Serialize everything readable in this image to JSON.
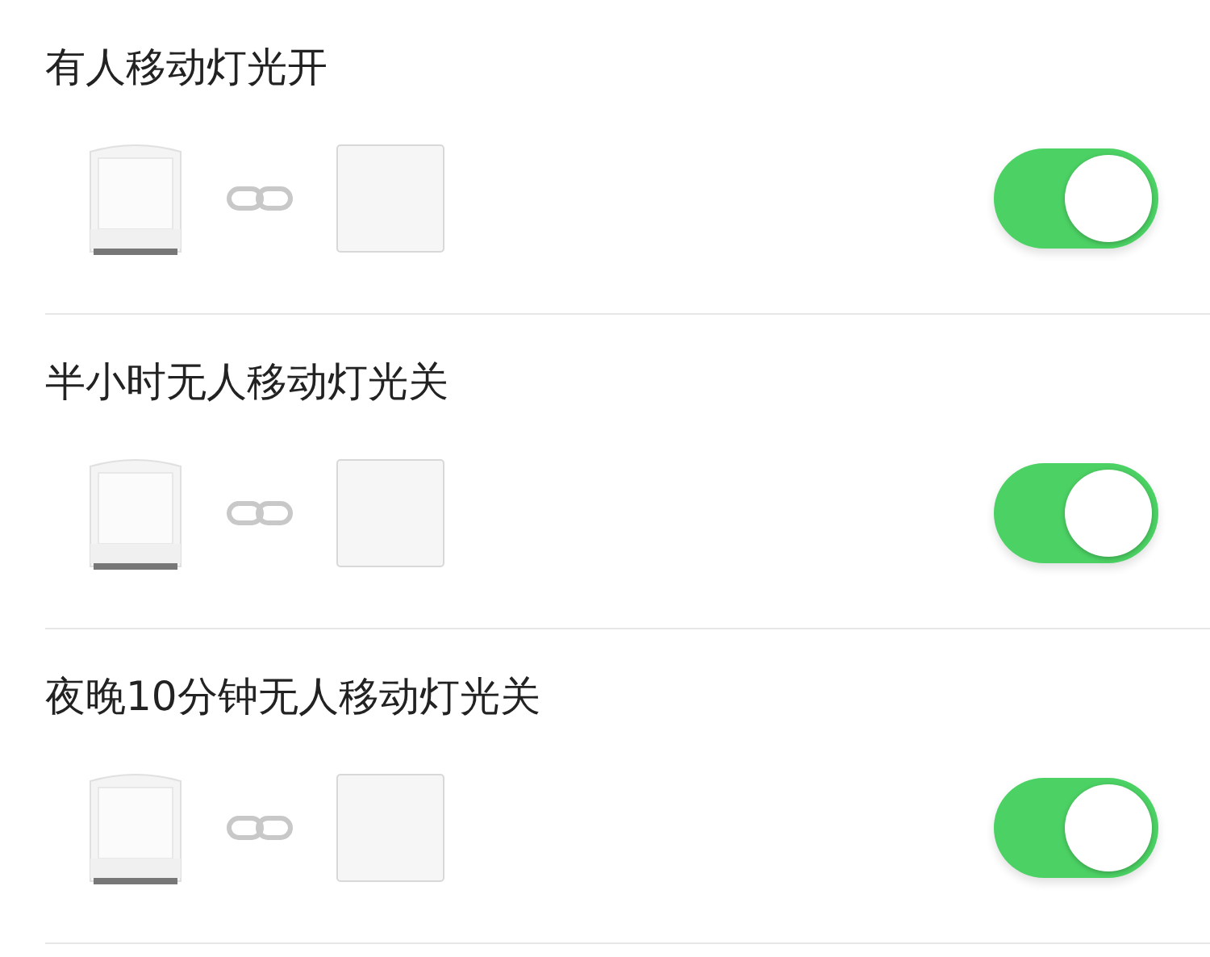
{
  "scenes": [
    {
      "title": "有人移动灯光开",
      "on": true
    },
    {
      "title": "半小时无人移动灯光关",
      "on": true
    },
    {
      "title": "夜晚10分钟无人移动灯光关",
      "on": true
    }
  ]
}
